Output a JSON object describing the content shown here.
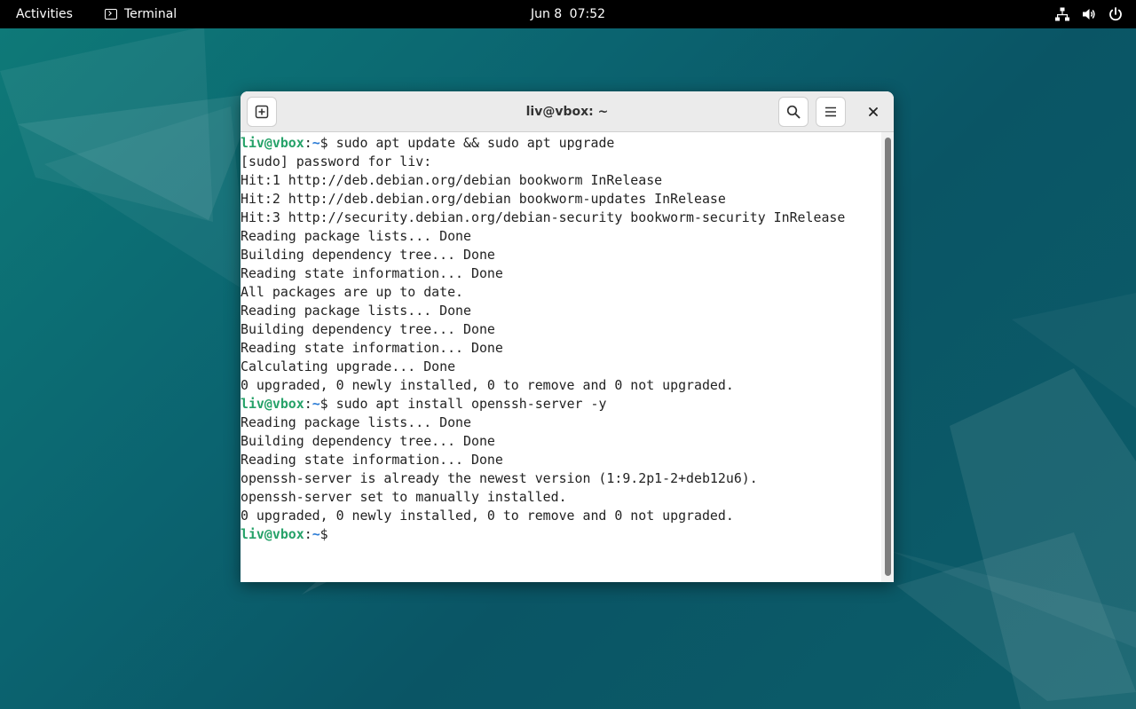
{
  "topbar": {
    "activities": "Activities",
    "app_name": "Terminal",
    "date": "Jun 8",
    "time": "07:52",
    "tray_icons": [
      "network-icon",
      "volume-icon",
      "power-icon"
    ]
  },
  "window": {
    "title": "liv@vbox: ~",
    "buttons": [
      "new-tab-icon",
      "search-icon",
      "hamburger-menu-icon",
      "close-icon"
    ]
  },
  "prompt": {
    "user_host": "liv@vbox",
    "separator": ":",
    "path": "~",
    "symbol": "$"
  },
  "terminal_lines": [
    {
      "prompt": true,
      "text": " sudo apt update && sudo apt upgrade"
    },
    {
      "prompt": false,
      "text": "[sudo] password for liv:"
    },
    {
      "prompt": false,
      "text": "Hit:1 http://deb.debian.org/debian bookworm InRelease"
    },
    {
      "prompt": false,
      "text": "Hit:2 http://deb.debian.org/debian bookworm-updates InRelease"
    },
    {
      "prompt": false,
      "text": "Hit:3 http://security.debian.org/debian-security bookworm-security InRelease"
    },
    {
      "prompt": false,
      "text": "Reading package lists... Done"
    },
    {
      "prompt": false,
      "text": "Building dependency tree... Done"
    },
    {
      "prompt": false,
      "text": "Reading state information... Done"
    },
    {
      "prompt": false,
      "text": "All packages are up to date."
    },
    {
      "prompt": false,
      "text": "Reading package lists... Done"
    },
    {
      "prompt": false,
      "text": "Building dependency tree... Done"
    },
    {
      "prompt": false,
      "text": "Reading state information... Done"
    },
    {
      "prompt": false,
      "text": "Calculating upgrade... Done"
    },
    {
      "prompt": false,
      "text": "0 upgraded, 0 newly installed, 0 to remove and 0 not upgraded."
    },
    {
      "prompt": true,
      "text": " sudo apt install openssh-server -y"
    },
    {
      "prompt": false,
      "text": "Reading package lists... Done"
    },
    {
      "prompt": false,
      "text": "Building dependency tree... Done"
    },
    {
      "prompt": false,
      "text": "Reading state information... Done"
    },
    {
      "prompt": false,
      "text": "openssh-server is already the newest version (1:9.2p1-2+deb12u6)."
    },
    {
      "prompt": false,
      "text": "openssh-server set to manually installed."
    },
    {
      "prompt": false,
      "text": "0 upgraded, 0 newly installed, 0 to remove and 0 not upgraded."
    },
    {
      "prompt": true,
      "text": ""
    }
  ],
  "colors": {
    "prompt_user": "#26a269",
    "prompt_path": "#2a7bd5",
    "topbar_bg": "#000000",
    "terminal_bg": "#ffffff"
  }
}
